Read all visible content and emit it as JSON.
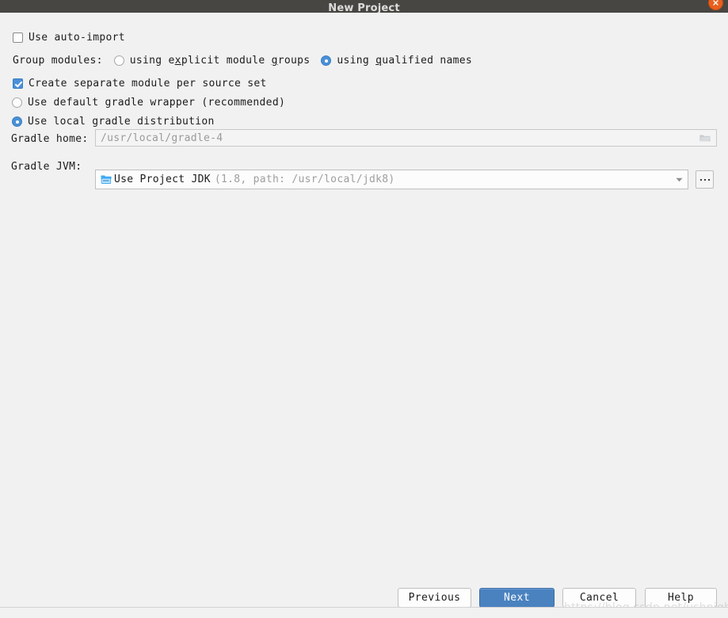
{
  "window": {
    "title": "New Project",
    "close_icon": "close-icon"
  },
  "options": {
    "auto_import": {
      "label": "Use auto-import",
      "checked": false
    },
    "group_modules": {
      "label": "Group modules:",
      "choices": [
        {
          "label_pre": "using e",
          "mnemonic": "x",
          "label_post": "plicit module ",
          "mnemonic2": "g",
          "label_post2": "roups",
          "full": "using explicit module groups",
          "selected": false
        },
        {
          "full": "using qualified names",
          "label_pre": "using ",
          "mnemonic": "q",
          "label_post": "ualified names",
          "selected": true
        }
      ]
    },
    "separate_module": {
      "label": "Create separate module per source set",
      "checked": true
    },
    "gradle_distribution": {
      "default_wrapper": {
        "label": "Use default gradle wrapper (recommended)",
        "selected": false
      },
      "local_distribution": {
        "label": "Use local gradle distribution",
        "selected": true
      }
    }
  },
  "fields": {
    "gradle_home": {
      "label": "Gradle home:",
      "value": "/usr/local/gradle-4",
      "browse_icon": "folder-icon"
    },
    "gradle_jvm": {
      "label": "Gradle JVM:",
      "value_main": "Use Project JDK",
      "value_detail": "(1.8, path: /usr/local/jdk8)",
      "icon": "jdk-icon",
      "arrow_icon": "chevron-down-icon",
      "browse_label": "..."
    }
  },
  "buttons": {
    "previous": "Previous",
    "next": "Next",
    "cancel": "Cancel",
    "help": "Help"
  },
  "watermark": {
    "text": "https://blog.csdn.net/ushnight"
  },
  "colors": {
    "titlebar": "#484642",
    "accent_blue": "#4a90d9",
    "primary_button": "#4a82c0",
    "close_button": "#e8601c",
    "panel": "#f1f1f1"
  }
}
